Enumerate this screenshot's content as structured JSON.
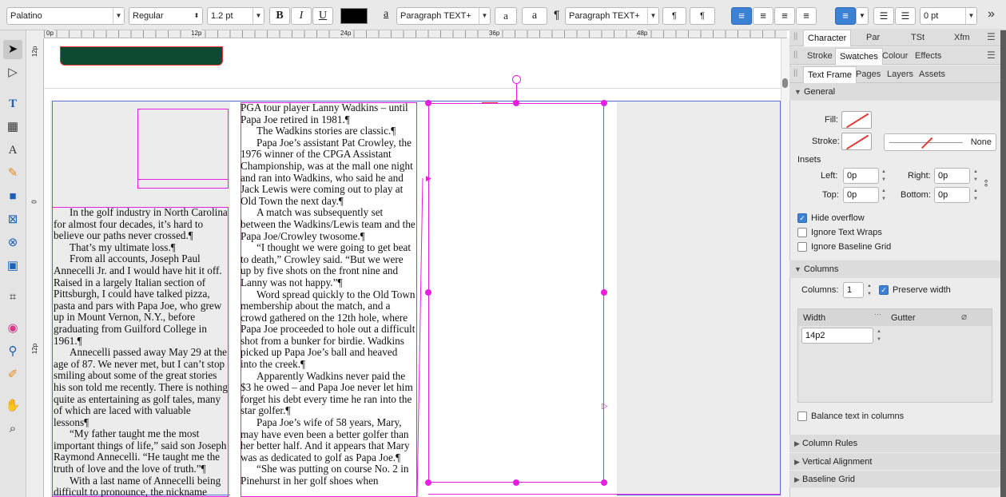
{
  "toolbar": {
    "font_family": "Palatino",
    "font_style": "Regular",
    "font_size": "1.2 pt",
    "bold": "B",
    "italic": "I",
    "underline": "U",
    "fill_color": "#000000",
    "char_style_icon": "a",
    "char_style": "Paragraph TEXT+",
    "char_style_btn1": "a",
    "char_style_btn2": "a",
    "para_mark": "¶",
    "para_style": "Paragraph TEXT+",
    "para_btn1": "¶",
    "para_btn2": "¶",
    "indent_value": "0 pt",
    "more": "»"
  },
  "ruler": {
    "h_ticks": [
      "0p",
      "12p",
      "24p",
      "36p",
      "48p"
    ],
    "v_ticks": [
      "12p",
      "0",
      "12p"
    ]
  },
  "columns": {
    "col1": [
      {
        "ni": false,
        "text": "In the golf industry in North Carolina for almost four decades, it’s hard to believe our paths never crossed.¶"
      },
      {
        "ni": false,
        "text": "That’s my ultimate loss.¶"
      },
      {
        "ni": false,
        "text": "From all accounts, Joseph Paul Annecelli Jr. and I would have hit it off. Raised in a largely Italian section of Pittsburgh, I could have talked pizza, pasta and pars with Papa Joe, who grew up in Mount Vernon, N.Y., before graduating from Guilford College in 1961.¶"
      },
      {
        "ni": false,
        "text": "Annecelli passed away May 29 at the age of 87. We never met, but I can’t stop smiling about some of the great stories his son told me recently. There is nothing quite as entertaining as golf tales, many of which are laced with valuable lessons¶"
      },
      {
        "ni": false,
        "text": "“My father taught me the most important things of life,” said son Joseph Raymond Annecelli. “He taught me the truth of love and the love of truth.”¶"
      },
      {
        "ni": false,
        "text": "With a last name of Annecelli being difficult to pronounce, the nickname"
      }
    ],
    "col2": [
      {
        "ni": true,
        "text": "PGA tour player Lanny Wadkins – until Papa Joe retired in 1981.¶"
      },
      {
        "ni": false,
        "text": "The Wadkins stories are classic.¶"
      },
      {
        "ni": false,
        "text": "Papa Joe’s assistant Pat Crowley, the 1976 winner of the CPGA Assistant Championship, was at the mall one night and ran into Wadkins, who said he and Jack Lewis were coming out to play at Old Town the next day.¶"
      },
      {
        "ni": false,
        "text": "A match was subsequently set between the Wadkins/Lewis team and the Papa Joe/Crowley twosome.¶"
      },
      {
        "ni": false,
        "text": "“I thought we were going to get beat to death,” Crowley said. “But we were up by five shots on the front nine and Lanny was not happy.”¶"
      },
      {
        "ni": false,
        "text": "Word spread quickly to the Old Town membership about the match, and a crowd gathered on the 12th hole, where Papa Joe proceeded to hole out a difficult shot from a bunker for birdie. Wadkins picked up Papa Joe’s ball and heaved into the creek.¶"
      },
      {
        "ni": false,
        "text": "Apparently Wadkins never paid the $3 he owed – and Papa Joe never let him forget his debt every time he ran into the star golfer.¶"
      },
      {
        "ni": false,
        "text": "Papa Joe’s wife of 58 years, Mary, may have even been a better golfer than her better half. And it appears that Mary was as dedicated to golf as Papa Joe.¶"
      },
      {
        "ni": false,
        "text": "“She was putting on course No. 2 in Pinehurst in her golf shoes when"
      }
    ]
  },
  "panel": {
    "tabs_row1": [
      "Character",
      "Par",
      "TSt",
      "Xfm"
    ],
    "tabs_row2": [
      "Stroke",
      "Swatches",
      "Colour",
      "Effects"
    ],
    "tabs_row3": [
      "Text Frame",
      "Pages",
      "Layers",
      "Assets"
    ],
    "general": "General",
    "fill_label": "Fill:",
    "stroke_label": "Stroke:",
    "stroke_none": "None",
    "insets": "Insets",
    "left_label": "Left:",
    "left_val": "0p",
    "right_label": "Right:",
    "right_val": "0p",
    "top_label": "Top:",
    "top_val": "0p",
    "bottom_label": "Bottom:",
    "bottom_val": "0p",
    "hide_overflow": "Hide overflow",
    "ignore_wraps": "Ignore Text Wraps",
    "ignore_grid": "Ignore Baseline Grid",
    "columns_hdr": "Columns",
    "columns_label": "Columns:",
    "columns_val": "1",
    "preserve_width": "Preserve width",
    "width_hdr": "Width",
    "gutter_hdr": "Gutter",
    "width_val": "14p2",
    "balance": "Balance text in columns",
    "column_rules": "Column Rules",
    "vertical_alignment": "Vertical Alignment",
    "baseline_grid": "Baseline Grid"
  },
  "colors": {
    "accent": "#3b82d6",
    "selection": "#e61fe0",
    "frame_red": "#e53935",
    "guide_blue": "#5b6fd6"
  }
}
